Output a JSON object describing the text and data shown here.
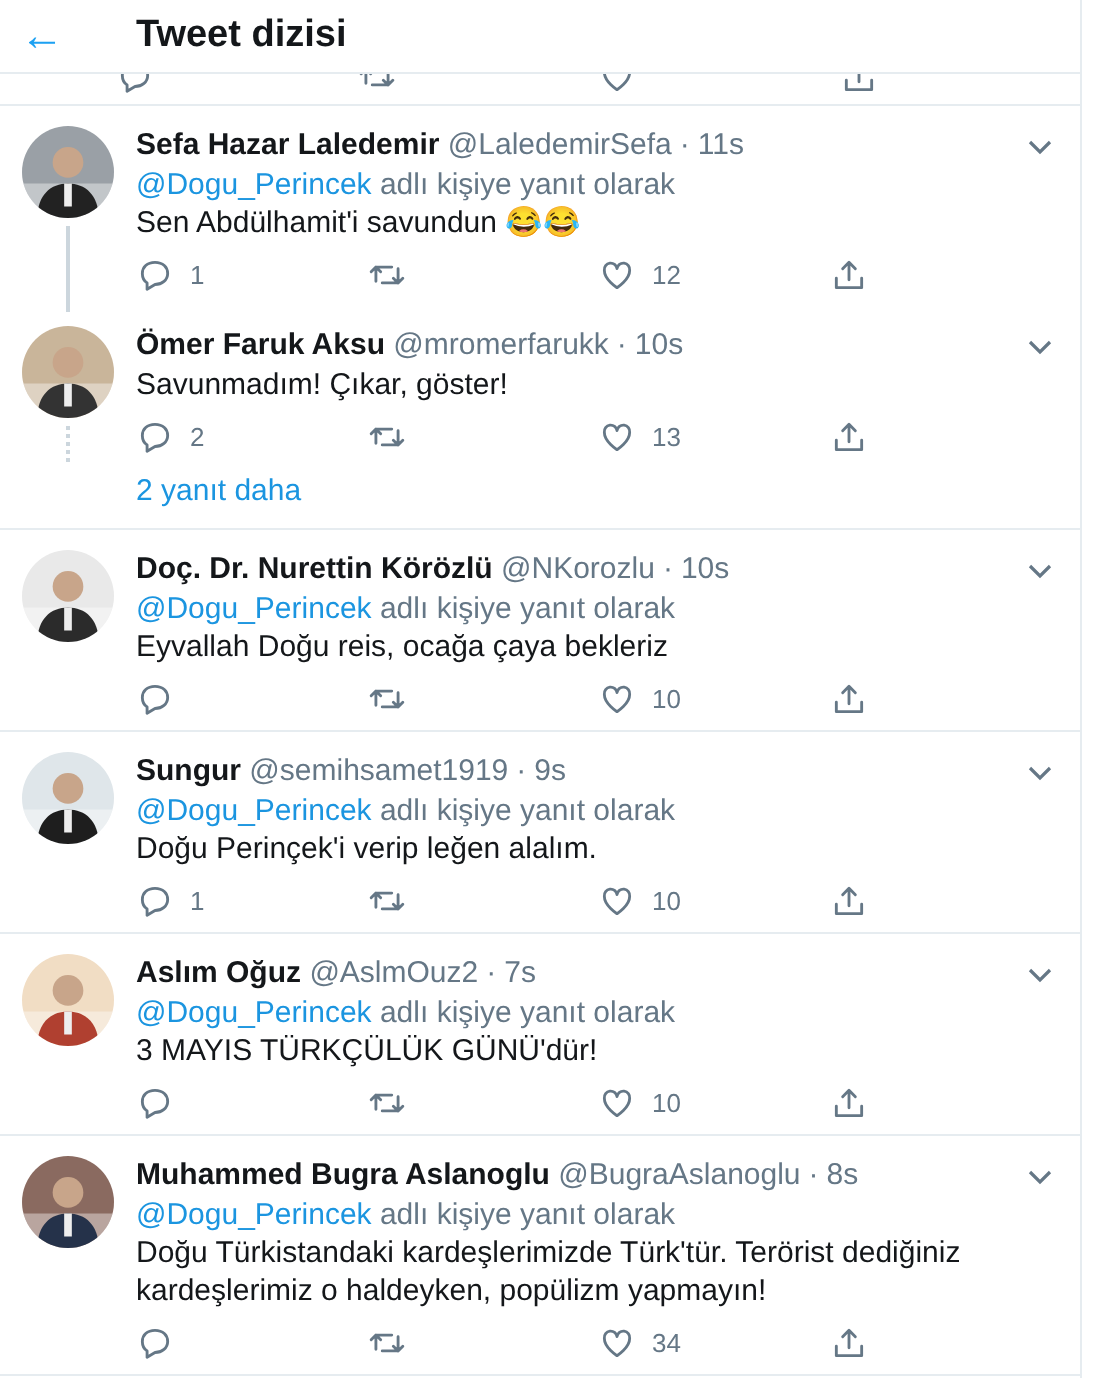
{
  "header": {
    "back": "←",
    "title": "Tweet dizisi"
  },
  "tweets": [
    {
      "name": "Sefa Hazar Laledemir",
      "handle": "@LaledemirSefa",
      "separator": "·",
      "time": "11s",
      "reply_to": "@Dogu_Perincek",
      "reply_suffix": "adlı kişiye yanıt olarak",
      "text": "Sen Abdülhamit'i savundun 😂😂",
      "replies": "1",
      "likes": "12",
      "connected": true
    },
    {
      "name": "Ömer Faruk Aksu",
      "handle": "@mromerfarukk",
      "separator": "·",
      "time": "10s",
      "text": "Savunmadım! Çıkar, göster!",
      "replies": "2",
      "likes": "13",
      "connected": false,
      "more_replies": "2 yanıt daha"
    },
    {
      "name": "Doç. Dr. Nurettin Körözlü",
      "handle": "@NKorozlu",
      "separator": "·",
      "time": "10s",
      "reply_to": "@Dogu_Perincek",
      "reply_suffix": "adlı kişiye yanıt olarak",
      "text": "Eyvallah Doğu reis, ocağa çaya bekleriz",
      "likes": "10",
      "connected": false
    },
    {
      "name": "Sungur",
      "handle": "@semihsamet1919",
      "separator": "·",
      "time": "9s",
      "reply_to": "@Dogu_Perincek",
      "reply_suffix": "adlı kişiye yanıt olarak",
      "text": "Doğu Perinçek'i verip leğen alalım.",
      "replies": "1",
      "likes": "10",
      "connected": false
    },
    {
      "name": "Aslım Oğuz",
      "handle": "@AslmOuz2",
      "separator": "·",
      "time": "7s",
      "reply_to": "@Dogu_Perincek",
      "reply_suffix": "adlı kişiye yanıt olarak",
      "text": "3 MAYIS TÜRKÇÜLÜK GÜNÜ'dür!",
      "likes": "10",
      "connected": false
    },
    {
      "name": "Muhammed Bugra Aslanoglu",
      "handle": "@BugraAslanoglu",
      "separator": "·",
      "time": "8s",
      "reply_to": "@Dogu_Perincek",
      "reply_suffix": "adlı kişiye yanıt olarak",
      "text": "Doğu Türkistandaki kardeşlerimizde Türk'tür. Terörist dediğiniz kardeşlerimiz o haldeyken, popülizm yapmayın!",
      "likes": "34",
      "connected": false
    }
  ]
}
